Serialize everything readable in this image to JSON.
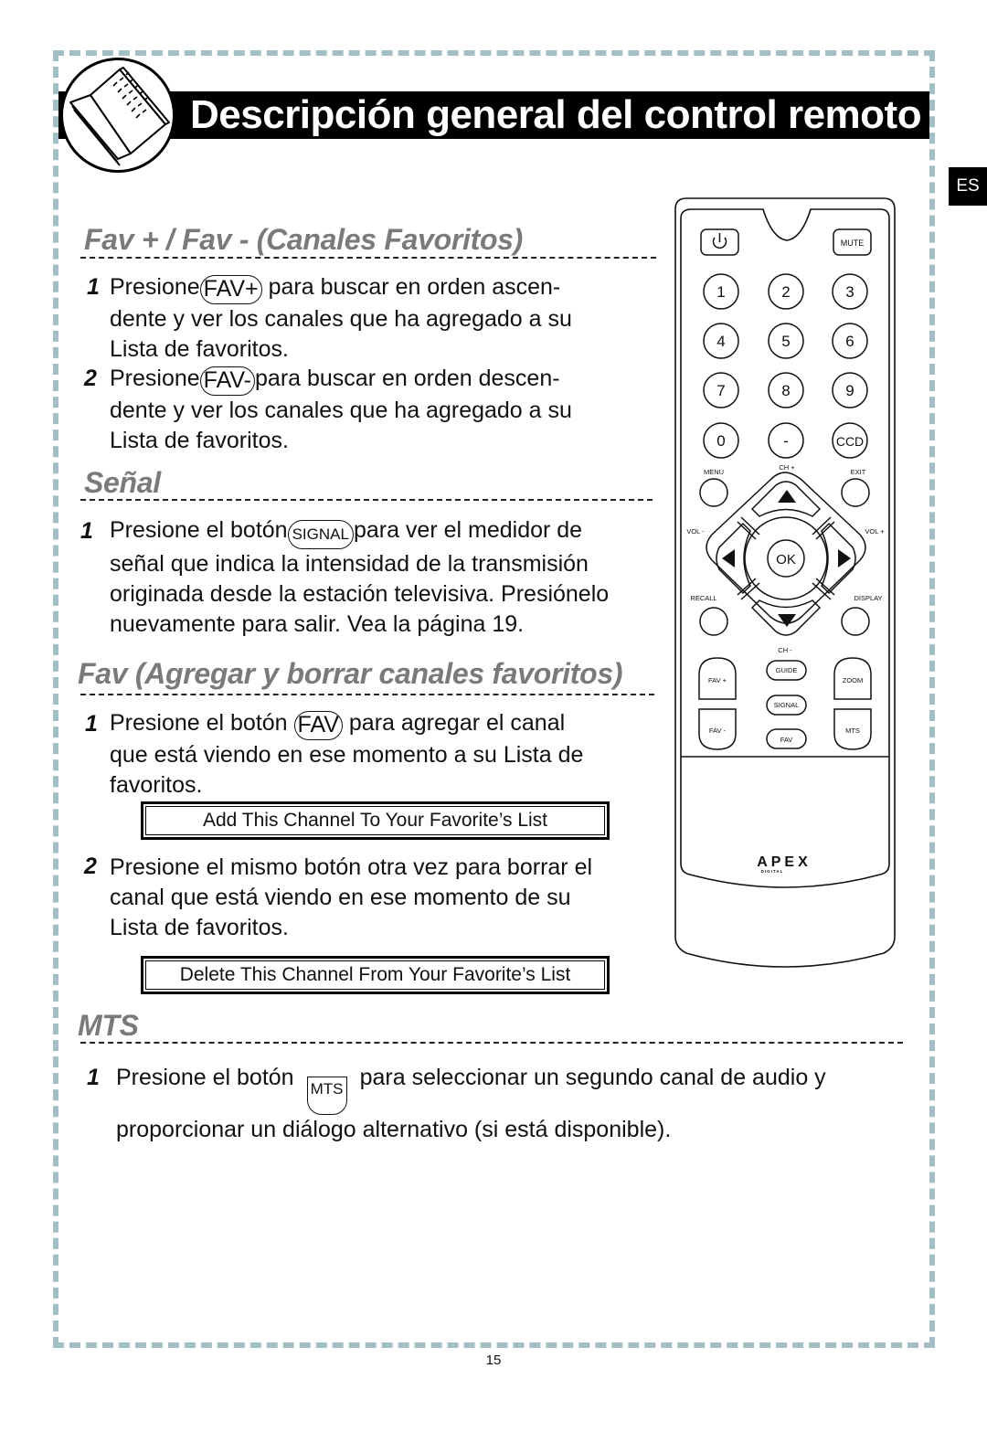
{
  "header": {
    "title": "Descripción general del control remoto",
    "icon": "open-book-icon",
    "language_tab": "ES"
  },
  "sections": {
    "fav_plus_minus": {
      "title": "Fav + / Fav -  (Canales Favoritos)",
      "steps": [
        {
          "num": "1",
          "pre": "Presione",
          "button": "FAV+",
          "line1_rest": " para buscar en orden ascen-",
          "line2": "dente y ver los canales que ha agregado a su",
          "line3": "Lista de favoritos."
        },
        {
          "num": "2",
          "pre": "Presione",
          "button": "FAV-",
          "line1_rest": "para buscar en orden descen-",
          "line2": "dente y ver los canales que ha agregado a su",
          "line3": "Lista de favoritos."
        }
      ]
    },
    "signal": {
      "title": "Señal",
      "steps": [
        {
          "num": "1",
          "pre": "Presione el botón",
          "button": "SIGNAL",
          "line1_rest": "para ver el medidor de",
          "line2": "señal que indica la intensidad de la transmisión",
          "line3": "originada desde la estación televisiva. Presiónelo",
          "line4": "nuevamente para salir. Vea la página 19."
        }
      ]
    },
    "fav_add_delete": {
      "title": "Fav (Agregar y borrar canales favoritos)",
      "steps": [
        {
          "num": "1",
          "pre": "Presione el botón",
          "button": "FAV",
          "line1_rest": "para agregar el canal",
          "line2": "que está viendo en ese momento a su Lista de",
          "line3": "favoritos.",
          "message": "Add This Channel To Your Favorite’s List"
        },
        {
          "num": "2",
          "line1": "Presione el mismo botón otra vez para borrar el",
          "line2": "canal que está viendo en ese momento de su",
          "line3": "Lista de favoritos.",
          "message": "Delete This Channel From Your Favorite’s List"
        }
      ]
    },
    "mts": {
      "title": "MTS",
      "steps": [
        {
          "num": "1",
          "pre": "Presione el botón",
          "button": "MTS",
          "line1_rest": "para seleccionar un segundo canal de audio y",
          "line2": "proporcionar un diálogo alternativo (si está disponible)."
        }
      ]
    }
  },
  "remote": {
    "power_icon": "power-icon",
    "mute": "MUTE",
    "digits": [
      "1",
      "2",
      "3",
      "4",
      "5",
      "6",
      "7",
      "8",
      "9",
      "0",
      "-",
      "CCD"
    ],
    "menu": "MENU",
    "exit": "EXIT",
    "ch_plus": "CH +",
    "ch_minus": "CH -",
    "vol_minus": "VOL -",
    "vol_plus": "VOL +",
    "ok": "OK",
    "recall": "RECALL",
    "display": "DISPLAY",
    "fav_plus": "FAV +",
    "fav_minus": "FAV -",
    "guide": "GUIDE",
    "signal": "SIGNAL",
    "fav": "FAV",
    "zoom": "ZOOM",
    "mts": "MTS",
    "brand": "APEX",
    "brand_sub": "DIGITAL"
  },
  "footer": {
    "page_number": "15"
  }
}
